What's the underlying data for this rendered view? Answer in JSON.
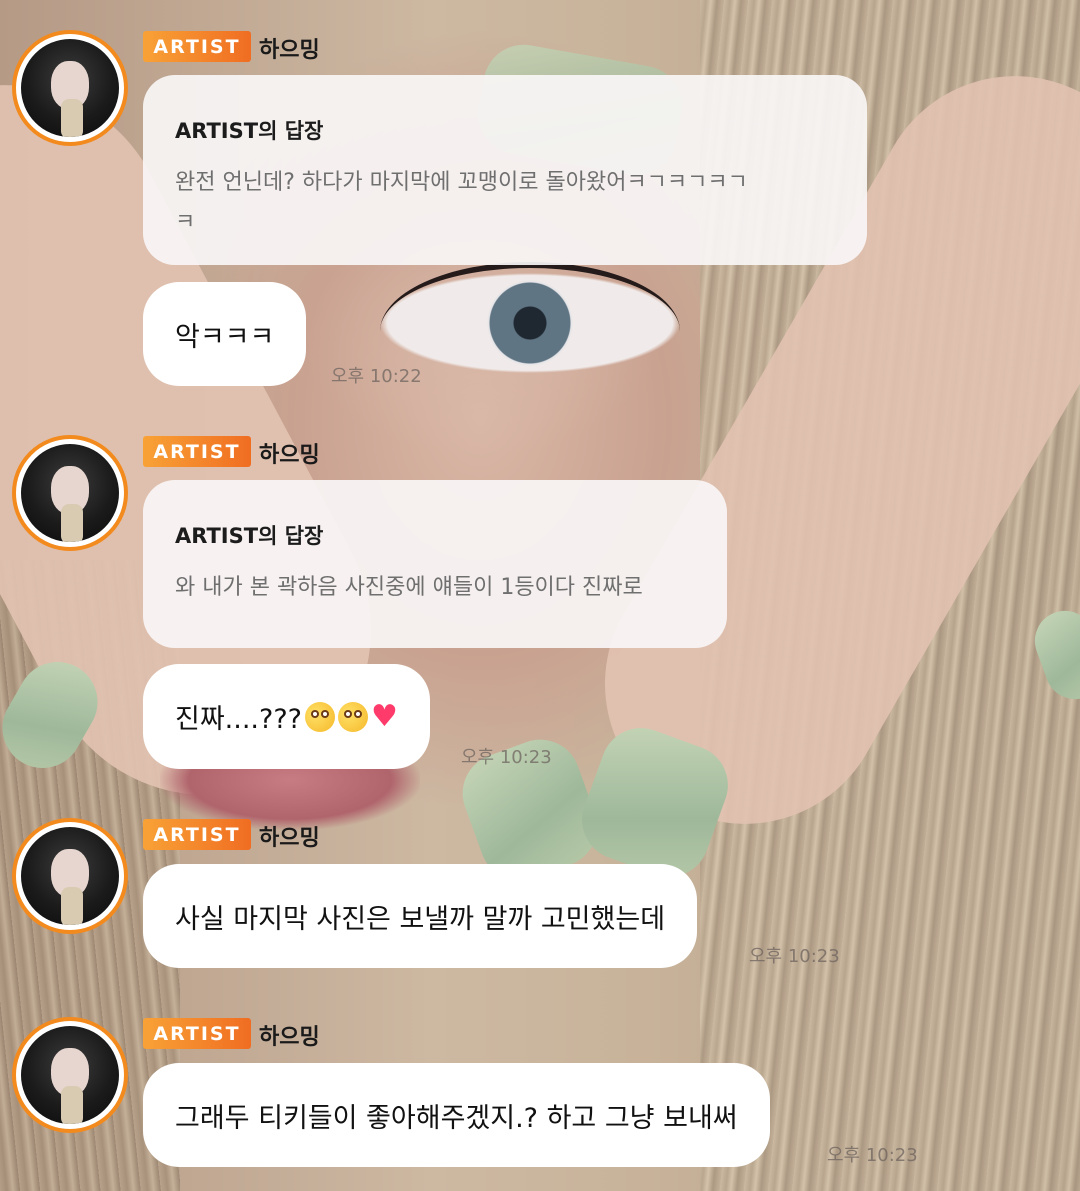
{
  "messages": [
    {
      "badge": "ARTIST",
      "sender": "하으밍",
      "reply_title": "ARTIST의 답장",
      "reply_text_line1": "완전 언닌데? 하다가 마지막에 꼬맹이로 돌아왔어ㅋㄱㅋㄱㅋㄱ",
      "reply_text_line2": "ㅋ",
      "text": "악ㅋㅋㅋ",
      "time": "오후 10:22"
    },
    {
      "badge": "ARTIST",
      "sender": "하으밍",
      "reply_title": "ARTIST의 답장",
      "reply_text_line1": "와 내가 본 곽하음 사진중에 얘들이 1등이다 진짜로",
      "text": "진짜....???",
      "emojis": [
        "flushed-face",
        "flushed-face",
        "red-heart"
      ],
      "time": "오후 10:23"
    },
    {
      "badge": "ARTIST",
      "sender": "하으밍",
      "text": "사실 마지막 사진은 보낼까 말까 고민했는데",
      "time": "오후 10:23"
    },
    {
      "badge": "ARTIST",
      "sender": "하으밍",
      "text": "그래두 티키들이 좋아해주겠지.? 하고 그냥 보내써",
      "time": "오후 10:23"
    }
  ],
  "colors": {
    "badge_start": "#f8a236",
    "badge_end": "#f06d22",
    "avatar_ring": "#f38a1e"
  }
}
